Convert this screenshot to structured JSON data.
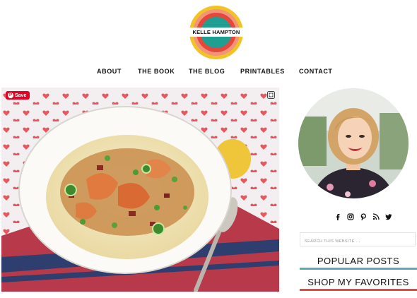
{
  "brand": {
    "logo_text": "KELLE HAMPTON"
  },
  "nav": {
    "items": [
      {
        "label": "ABOUT"
      },
      {
        "label": "THE BOOK"
      },
      {
        "label": "THE BLOG"
      },
      {
        "label": "PRINTABLES"
      },
      {
        "label": "CONTACT"
      }
    ]
  },
  "featured_image": {
    "save_label": "Save",
    "icons": [
      "pinterest-icon",
      "expand-icon"
    ]
  },
  "sidebar": {
    "social_icons": [
      "facebook-icon",
      "instagram-icon",
      "pinterest-icon",
      "rss-icon",
      "twitter-icon"
    ],
    "search": {
      "placeholder": "SEARCH THIS WEBSITE ..."
    },
    "widgets": [
      {
        "title": "POPULAR POSTS",
        "accent": "#5fa9b5"
      },
      {
        "title": "SHOP MY FAVORITES",
        "accent": "#e04a3f"
      }
    ]
  },
  "colors": {
    "logo_yellow": "#f2c326",
    "logo_peach": "#f1947a",
    "logo_red": "#e4483b",
    "logo_teal": "#1f9e92",
    "pinterest_red": "#e60023"
  }
}
